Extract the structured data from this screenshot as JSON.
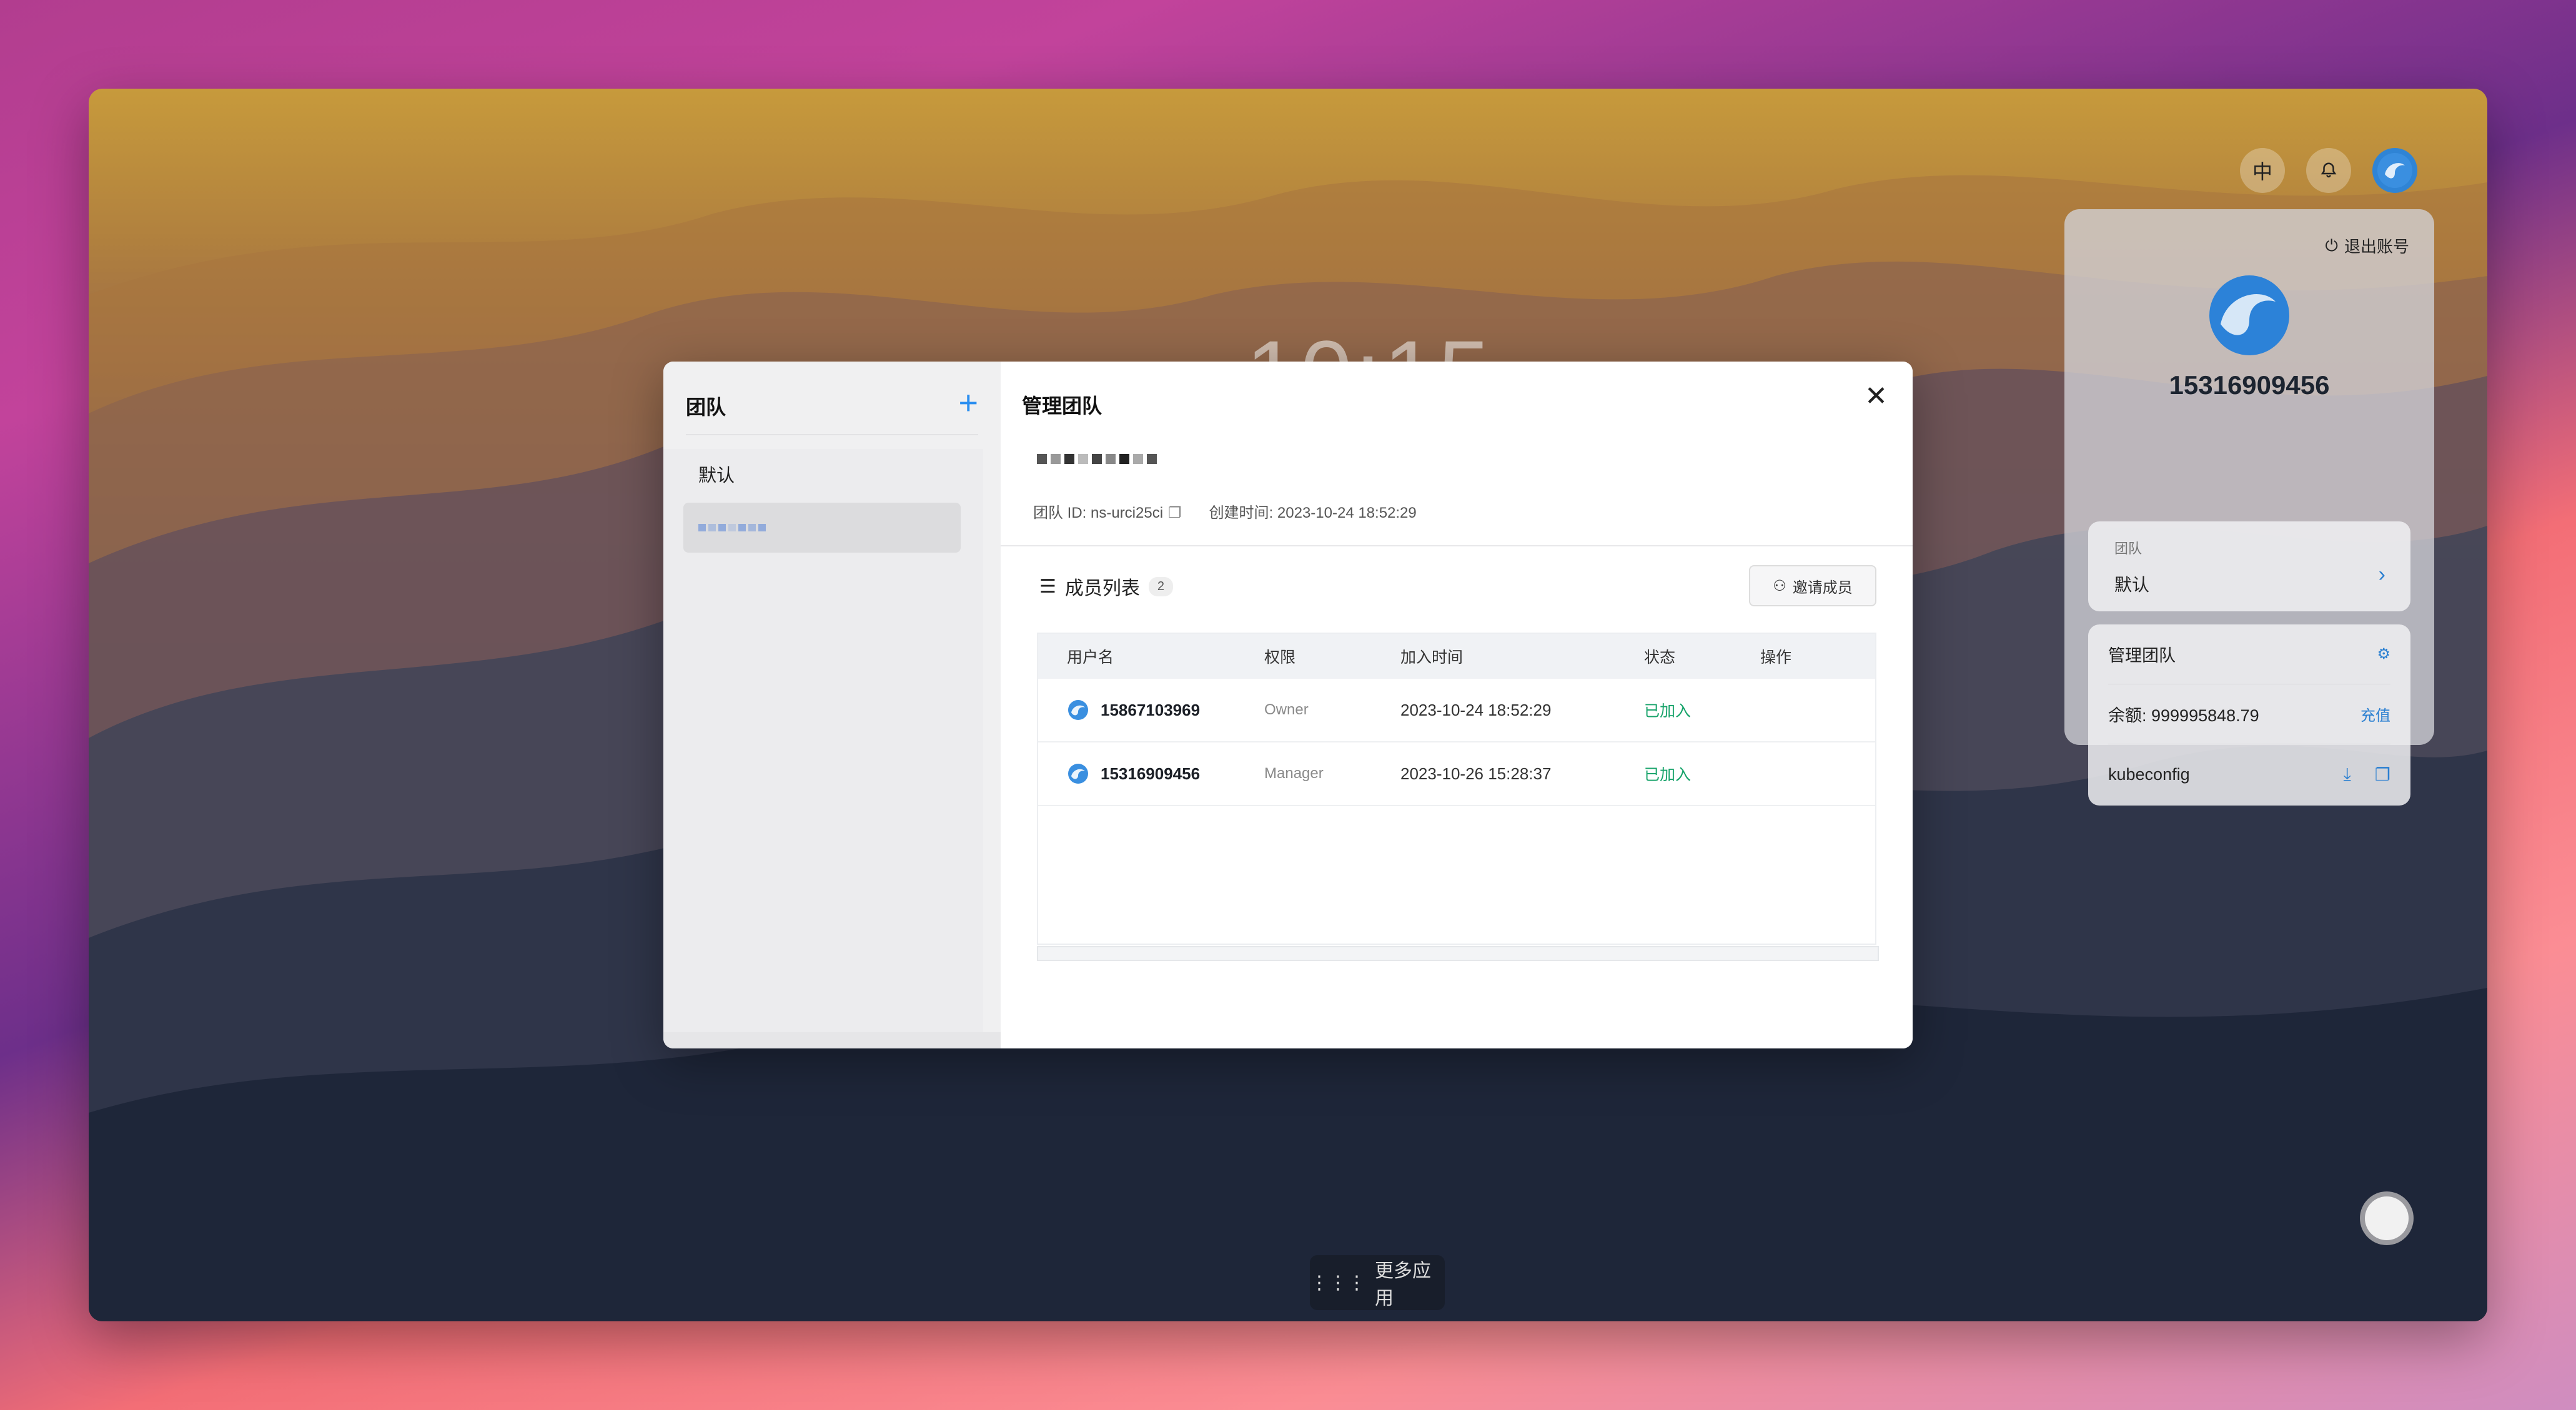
{
  "desktop": {
    "clock": "10:15",
    "more_apps_label": "更多应用"
  },
  "topbar": {
    "lang_label": "中",
    "notification_icon": "bell-icon",
    "avatar_icon": "user-avatar-icon"
  },
  "user_panel": {
    "logout_label": "退出账号",
    "username": "15316909456",
    "team_label": "团队",
    "team_value": "默认",
    "manage_team_label": "管理团队",
    "balance_label": "余额: 999995848.79",
    "recharge_label": "充值",
    "kubeconfig_label": "kubeconfig"
  },
  "dialog": {
    "sidebar": {
      "title": "团队",
      "add_icon": "plus-icon",
      "items": [
        {
          "label": "默认"
        }
      ]
    },
    "main": {
      "title": "管理团队",
      "team_id_label": "团队 ID: ns-urci25ci",
      "created_label": "创建时间: 2023-10-24 18:52:29",
      "members_title": "成员列表",
      "members_count": "2",
      "invite_label": "邀请成员",
      "table": {
        "headers": [
          "用户名",
          "权限",
          "加入时间",
          "状态",
          "操作"
        ],
        "rows": [
          {
            "username": "15867103969",
            "role": "Owner",
            "joined_at": "2023-10-24 18:52:29",
            "status": "已加入"
          },
          {
            "username": "15316909456",
            "role": "Manager",
            "joined_at": "2023-10-26 15:28:37",
            "status": "已加入"
          }
        ]
      }
    }
  },
  "colors": {
    "accent": "#2a8ef0",
    "status_green": "#17a36a"
  }
}
